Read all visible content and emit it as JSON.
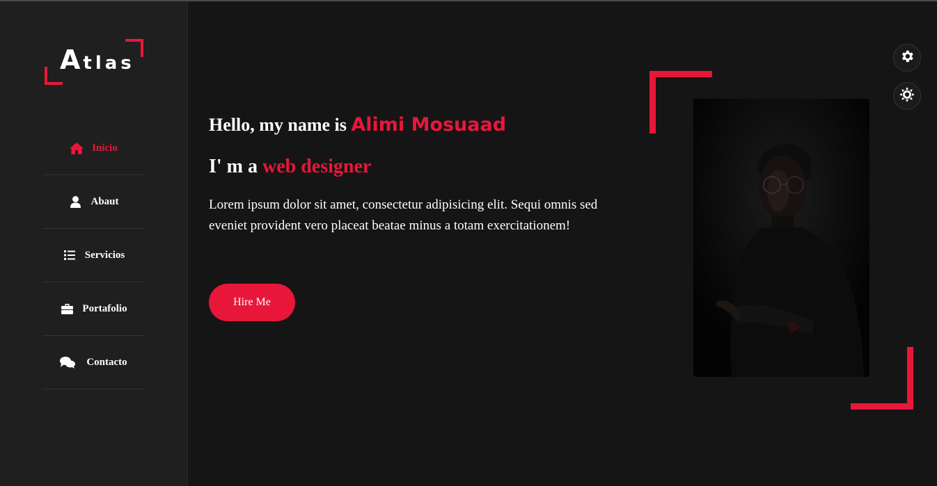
{
  "logo": {
    "first_letter": "A",
    "rest": "tlas"
  },
  "nav": {
    "items": [
      {
        "label": "Inicio",
        "icon": "home-icon",
        "active": true
      },
      {
        "label": "Abaut",
        "icon": "user-icon",
        "active": false
      },
      {
        "label": "Servicios",
        "icon": "list-icon",
        "active": false
      },
      {
        "label": "Portafolio",
        "icon": "briefcase-icon",
        "active": false
      },
      {
        "label": "Contacto",
        "icon": "chat-icon",
        "active": false
      }
    ]
  },
  "hero": {
    "greeting": "Hello, my name is",
    "name": "Alimi Mosuaad",
    "role_prefix": "I' m a",
    "role": "web designer",
    "description": "Lorem ipsum dolor sit amet, consectetur adipisicing elit. Sequi omnis sed eveniet provident vero placeat beatae minus a totam exercitationem!",
    "cta_label": "Hire Me"
  },
  "settings": {
    "icon": "gear-icon",
    "theme_icon": "sun-icon"
  },
  "colors": {
    "accent": "#e8173a",
    "background": "#151515",
    "sidebar": "#1f1f1f"
  }
}
